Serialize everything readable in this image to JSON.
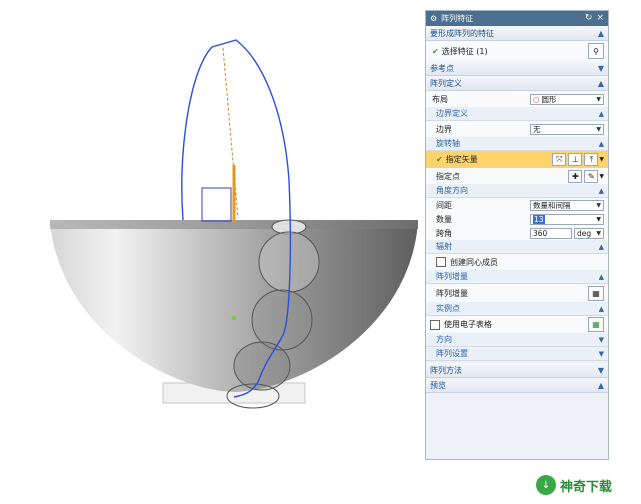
{
  "dialog": {
    "title": "阵列特征",
    "sections": {
      "features_to_pattern": "要形成阵列的特征",
      "select_feature": "选择特征 (1)",
      "reference_point": "参考点",
      "pattern_definition": "阵列定义",
      "layout_label": "布局",
      "layout_value": "圆形",
      "boundary_definition": "边界定义",
      "boundary_label": "边界",
      "boundary_value": "无",
      "rotation_axis": "旋转轴",
      "specify_vector": "指定矢量",
      "specify_point": "指定点",
      "angular_direction": "角度方向",
      "spacing_label": "间距",
      "spacing_value": "数量和间隔",
      "count_label": "数量",
      "count_value": "13",
      "pitch_label": "跨角",
      "pitch_value": "360",
      "pitch_unit": "deg",
      "radiate": "辐射",
      "create_concentric": "创建同心成员",
      "pattern_increment": "阵列增量",
      "pattern_increment_row": "阵列增量",
      "instance_points": "实例点",
      "use_spreadsheet": "使用电子表格",
      "orientation": "方向",
      "pattern_settings": "阵列设置",
      "pattern_method": "阵列方法",
      "preview": "预览"
    }
  },
  "watermark": {
    "text": "神奇下载",
    "brand_color": "#2c8c3a"
  },
  "colors": {
    "title_bar": "#4a6f8f",
    "section_text": "#1f4f8c",
    "highlight": "#ffd36b",
    "curve": "#2a4fe0"
  }
}
